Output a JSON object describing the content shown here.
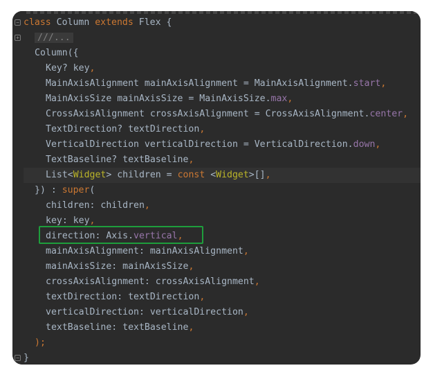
{
  "editor": {
    "lines": [
      {
        "indent": 0,
        "tokens": [
          {
            "t": "class ",
            "c": "kw"
          },
          {
            "t": "Column ",
            "c": ""
          },
          {
            "t": "extends ",
            "c": "kw"
          },
          {
            "t": "Flex {",
            "c": ""
          }
        ]
      },
      {
        "indent": 1,
        "tokens": [
          {
            "t": "///...",
            "c": "comment-box"
          }
        ]
      },
      {
        "indent": 1,
        "tokens": [
          {
            "t": "Column({",
            "c": ""
          }
        ]
      },
      {
        "indent": 2,
        "tokens": [
          {
            "t": "Key? key",
            "c": ""
          },
          {
            "t": ",",
            "c": "kw"
          }
        ]
      },
      {
        "indent": 2,
        "tokens": [
          {
            "t": "MainAxisAlignment mainAxisAlignment = MainAxisAlignment.",
            "c": ""
          },
          {
            "t": "start",
            "c": "fld"
          },
          {
            "t": ",",
            "c": "kw"
          }
        ]
      },
      {
        "indent": 2,
        "tokens": [
          {
            "t": "MainAxisSize mainAxisSize = MainAxisSize.",
            "c": ""
          },
          {
            "t": "max",
            "c": "fld"
          },
          {
            "t": ",",
            "c": "kw"
          }
        ]
      },
      {
        "indent": 2,
        "tokens": [
          {
            "t": "CrossAxisAlignment crossAxisAlignment = CrossAxisAlignment.",
            "c": ""
          },
          {
            "t": "center",
            "c": "fld"
          },
          {
            "t": ",",
            "c": "kw"
          }
        ]
      },
      {
        "indent": 2,
        "tokens": [
          {
            "t": "TextDirection? textDirection",
            "c": ""
          },
          {
            "t": ",",
            "c": "kw"
          }
        ]
      },
      {
        "indent": 2,
        "tokens": [
          {
            "t": "VerticalDirection verticalDirection = VerticalDirection.",
            "c": ""
          },
          {
            "t": "down",
            "c": "fld"
          },
          {
            "t": ",",
            "c": "kw"
          }
        ]
      },
      {
        "indent": 2,
        "tokens": [
          {
            "t": "TextBaseline? textBaseline",
            "c": ""
          },
          {
            "t": ",",
            "c": "kw"
          }
        ]
      },
      {
        "indent": 2,
        "highlight": true,
        "tokens": [
          {
            "t": "List<",
            "c": ""
          },
          {
            "t": "Widget",
            "c": "anno"
          },
          {
            "t": "> children = ",
            "c": ""
          },
          {
            "t": "const ",
            "c": "kw"
          },
          {
            "t": "<",
            "c": ""
          },
          {
            "t": "Widget",
            "c": "anno"
          },
          {
            "t": ">[]",
            "c": ""
          },
          {
            "t": ",",
            "c": "kw"
          }
        ]
      },
      {
        "indent": 1,
        "tokens": [
          {
            "t": "}) : ",
            "c": ""
          },
          {
            "t": "super",
            "c": "kw"
          },
          {
            "t": "(",
            "c": ""
          }
        ]
      },
      {
        "indent": 2,
        "tokens": [
          {
            "t": "children: children",
            "c": ""
          },
          {
            "t": ",",
            "c": "kw"
          }
        ]
      },
      {
        "indent": 2,
        "tokens": [
          {
            "t": "key: key",
            "c": ""
          },
          {
            "t": ",",
            "c": "kw"
          }
        ]
      },
      {
        "indent": 2,
        "tokens": [
          {
            "t": "direction: Axis.",
            "c": ""
          },
          {
            "t": "vertical",
            "c": "fld"
          },
          {
            "t": ",",
            "c": "kw"
          }
        ]
      },
      {
        "indent": 2,
        "tokens": [
          {
            "t": "mainAxisAlignment: mainAxisAlignment",
            "c": ""
          },
          {
            "t": ",",
            "c": "kw"
          }
        ]
      },
      {
        "indent": 2,
        "tokens": [
          {
            "t": "mainAxisSize: mainAxisSize",
            "c": ""
          },
          {
            "t": ",",
            "c": "kw"
          }
        ]
      },
      {
        "indent": 2,
        "tokens": [
          {
            "t": "crossAxisAlignment: crossAxisAlignment",
            "c": ""
          },
          {
            "t": ",",
            "c": "kw"
          }
        ]
      },
      {
        "indent": 2,
        "tokens": [
          {
            "t": "textDirection: textDirection",
            "c": ""
          },
          {
            "t": ",",
            "c": "kw"
          }
        ]
      },
      {
        "indent": 2,
        "tokens": [
          {
            "t": "verticalDirection: verticalDirection",
            "c": ""
          },
          {
            "t": ",",
            "c": "kw"
          }
        ]
      },
      {
        "indent": 2,
        "tokens": [
          {
            "t": "textBaseline: textBaseline",
            "c": ""
          },
          {
            "t": ",",
            "c": "kw"
          }
        ]
      },
      {
        "indent": 1,
        "tokens": [
          {
            "t": ");",
            "c": "kw"
          }
        ]
      },
      {
        "indent": 0,
        "tokens": [
          {
            "t": "}",
            "c": ""
          }
        ]
      }
    ],
    "fold_markers": [
      {
        "line": 0,
        "glyph": "−"
      },
      {
        "line": 1,
        "glyph": "+"
      },
      {
        "line": 22,
        "glyph": "−"
      }
    ]
  },
  "colors": {
    "background": "#2b2b2b",
    "keyword": "#cc7832",
    "field": "#9876aa",
    "annotation": "#bbb529",
    "text": "#a9b7c6",
    "highlight_box": "#1e9e3c"
  },
  "icons": [
    "fold-collapse-icon",
    "fold-expand-icon"
  ]
}
